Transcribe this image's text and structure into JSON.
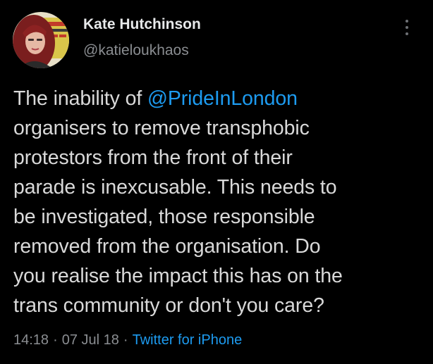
{
  "author": {
    "display_name": "Kate Hutchinson",
    "handle": "@katieloukhaos",
    "avatar_icon": "profile-photo"
  },
  "tweet": {
    "lines": [
      {
        "prefix": "The inability of ",
        "mention": "@PrideInLondon"
      },
      {
        "text": "organisers to remove transphobic"
      },
      {
        "text": "protestors from the front of their"
      },
      {
        "text": "parade is inexcusable. This needs to"
      },
      {
        "text": "be investigated, those responsible"
      },
      {
        "text": "removed from the organisation. Do"
      },
      {
        "text": "you realise the impact this has on the"
      },
      {
        "text": "trans community or don't you care?"
      }
    ]
  },
  "meta": {
    "time": "14:18",
    "date": "07 Jul 18",
    "separator": "·",
    "source": "Twitter for iPhone"
  },
  "colors": {
    "background": "#000000",
    "text": "#d9d9d9",
    "secondary": "#8a8d91",
    "link": "#1d9bf0"
  },
  "icons": {
    "more": "more-vertical-icon"
  }
}
